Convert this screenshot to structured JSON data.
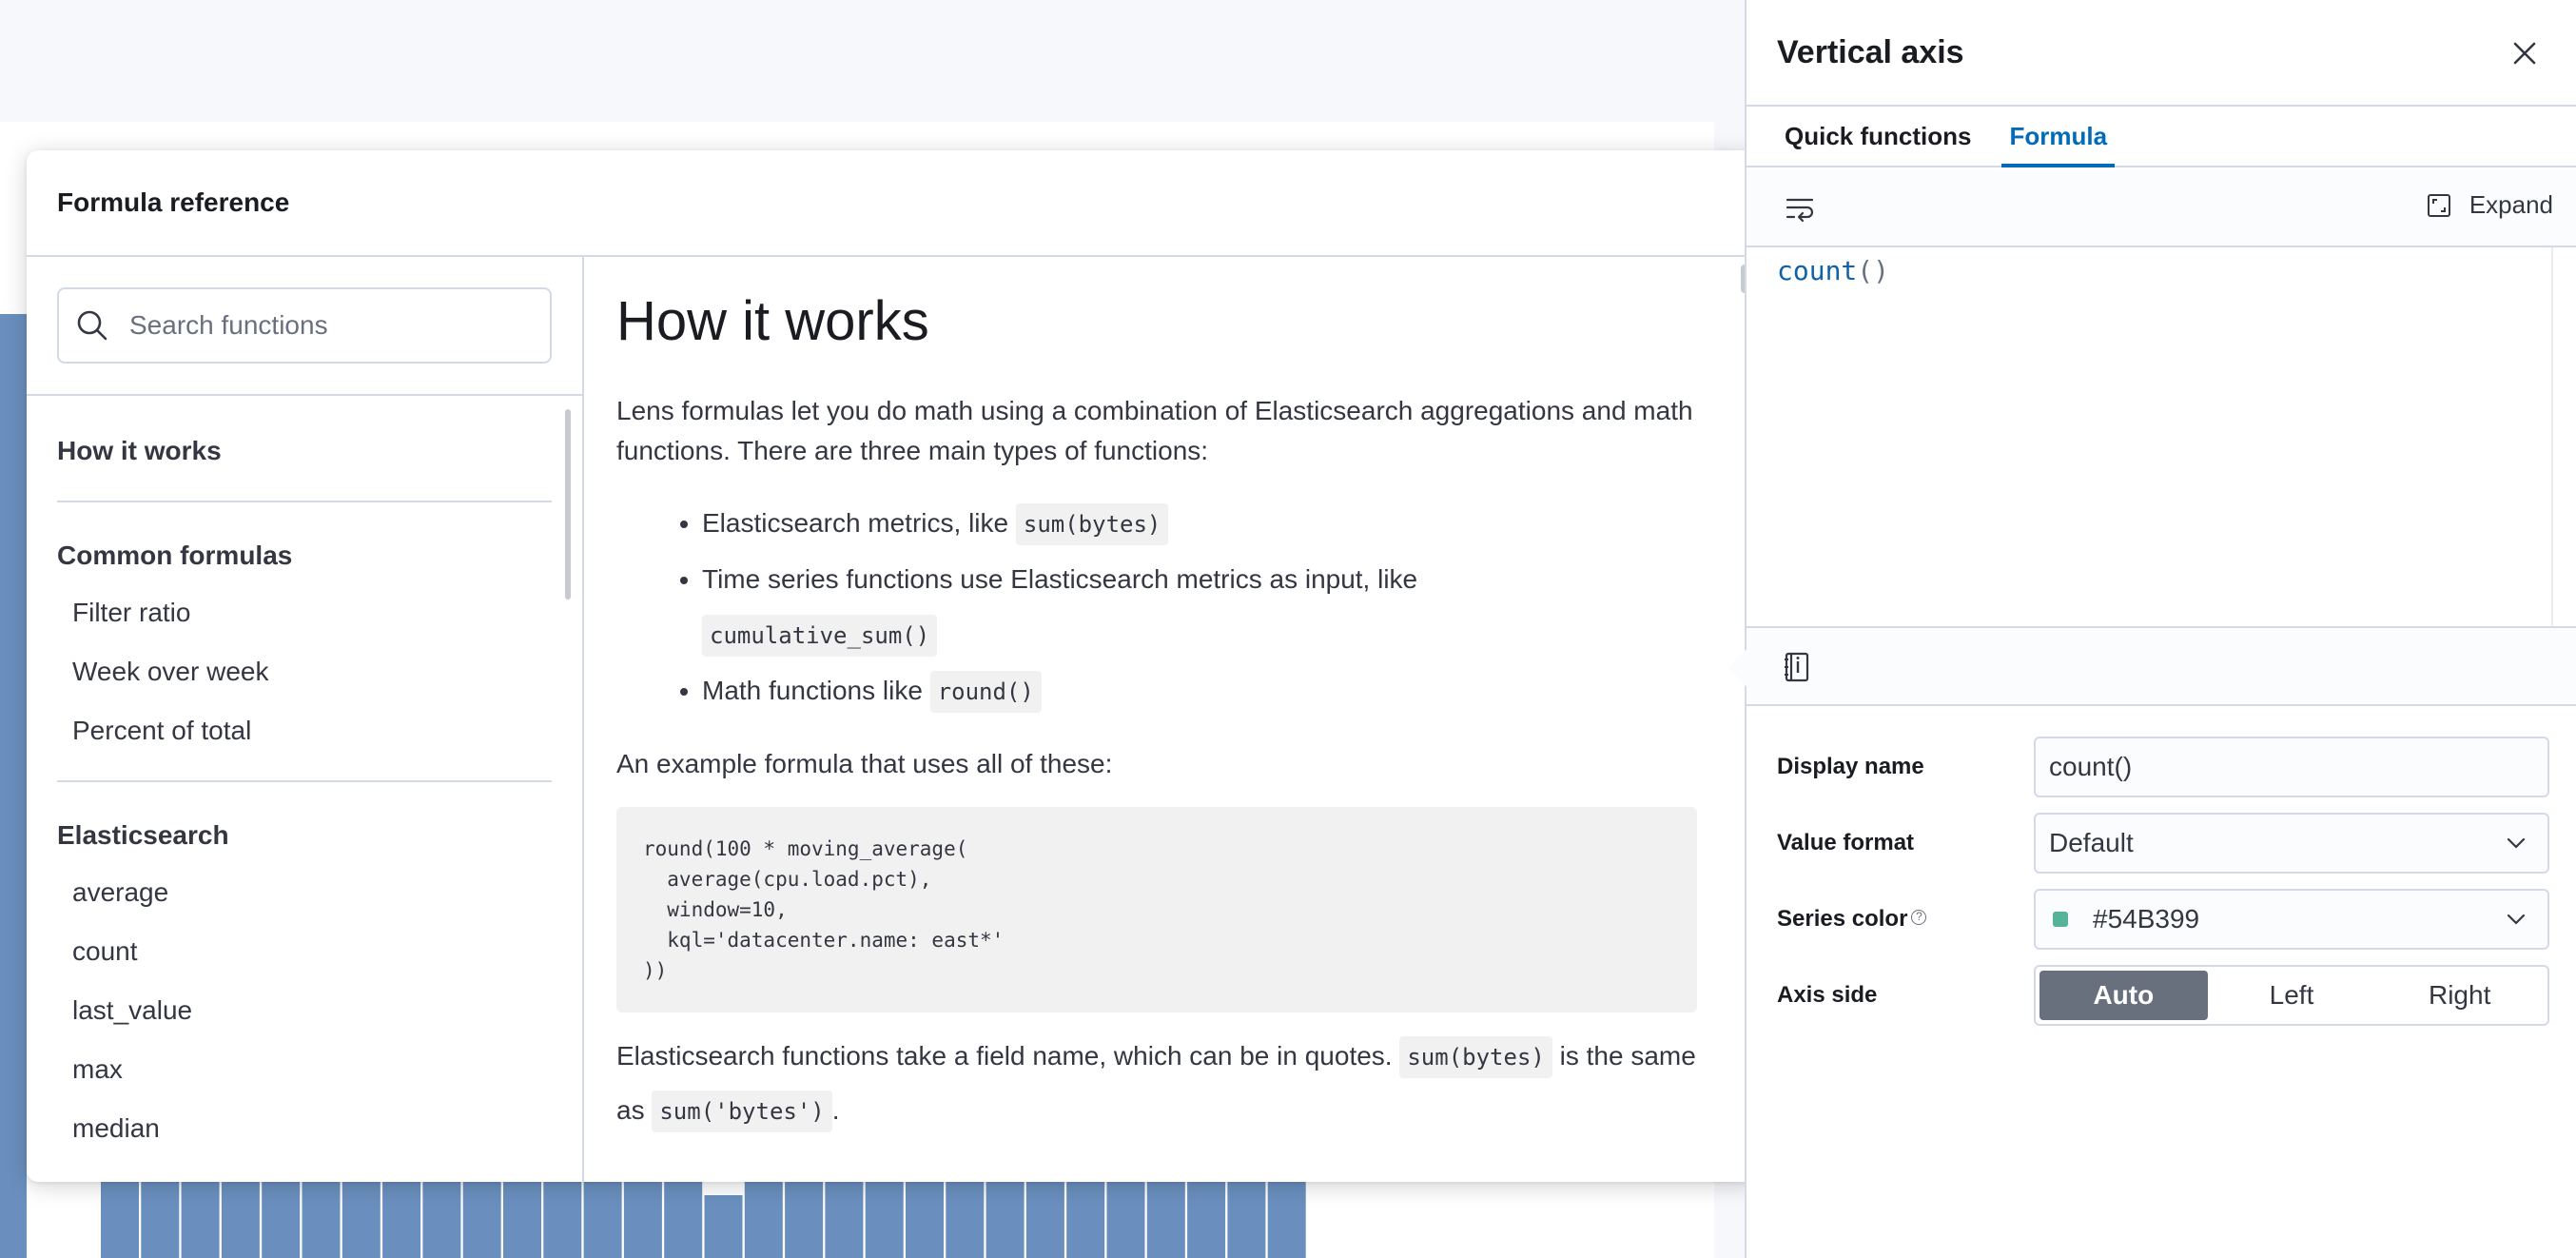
{
  "colors": {
    "accent": "#006bb8",
    "bar": "#6a8fbe",
    "series": "#54B399"
  },
  "background_chart": {
    "bar_count": 30
  },
  "reference": {
    "title": "Formula reference",
    "search_placeholder": "Search functions",
    "sections": [
      {
        "heading": "How it works",
        "items": []
      },
      {
        "heading": "Common formulas",
        "items": [
          "Filter ratio",
          "Week over week",
          "Percent of total"
        ]
      },
      {
        "heading": "Elasticsearch",
        "items": [
          "average",
          "count",
          "last_value",
          "max",
          "median"
        ]
      }
    ],
    "content": {
      "heading": "How it works",
      "intro": "Lens formulas let you do math using a combination of Elasticsearch aggregations and math functions. There are three main types of functions:",
      "bullets": [
        {
          "text": "Elasticsearch metrics, like ",
          "code": "sum(bytes)"
        },
        {
          "text": "Time series functions use Elasticsearch metrics as input, like ",
          "code": "cumulative_sum()"
        },
        {
          "text": "Math functions like ",
          "code": "round()"
        }
      ],
      "example_intro": "An example formula that uses all of these:",
      "example_code": "round(100 * moving_average(\n  average(cpu.load.pct),\n  window=10,\n  kql='datacenter.name: east*'\n))",
      "fields_text_1": "Elasticsearch functions take a field name, which can be in quotes.",
      "fields_code_1": "sum(bytes)",
      "fields_text_2": "is the same as",
      "fields_code_2": "sum('bytes')",
      "fields_text_3": "."
    }
  },
  "flyout": {
    "title": "Vertical axis",
    "tabs": [
      "Quick functions",
      "Formula"
    ],
    "active_tab": "Formula",
    "expand_label": "Expand",
    "formula": {
      "fn": "count",
      "parens": "()"
    },
    "fields": {
      "display_name_label": "Display name",
      "display_name_value": "count()",
      "value_format_label": "Value format",
      "value_format_value": "Default",
      "series_color_label": "Series color",
      "series_color_help": "?",
      "series_color_value": "#54B399",
      "axis_side_label": "Axis side",
      "axis_side_options": [
        "Auto",
        "Left",
        "Right"
      ],
      "axis_side_selected": "Auto"
    }
  }
}
